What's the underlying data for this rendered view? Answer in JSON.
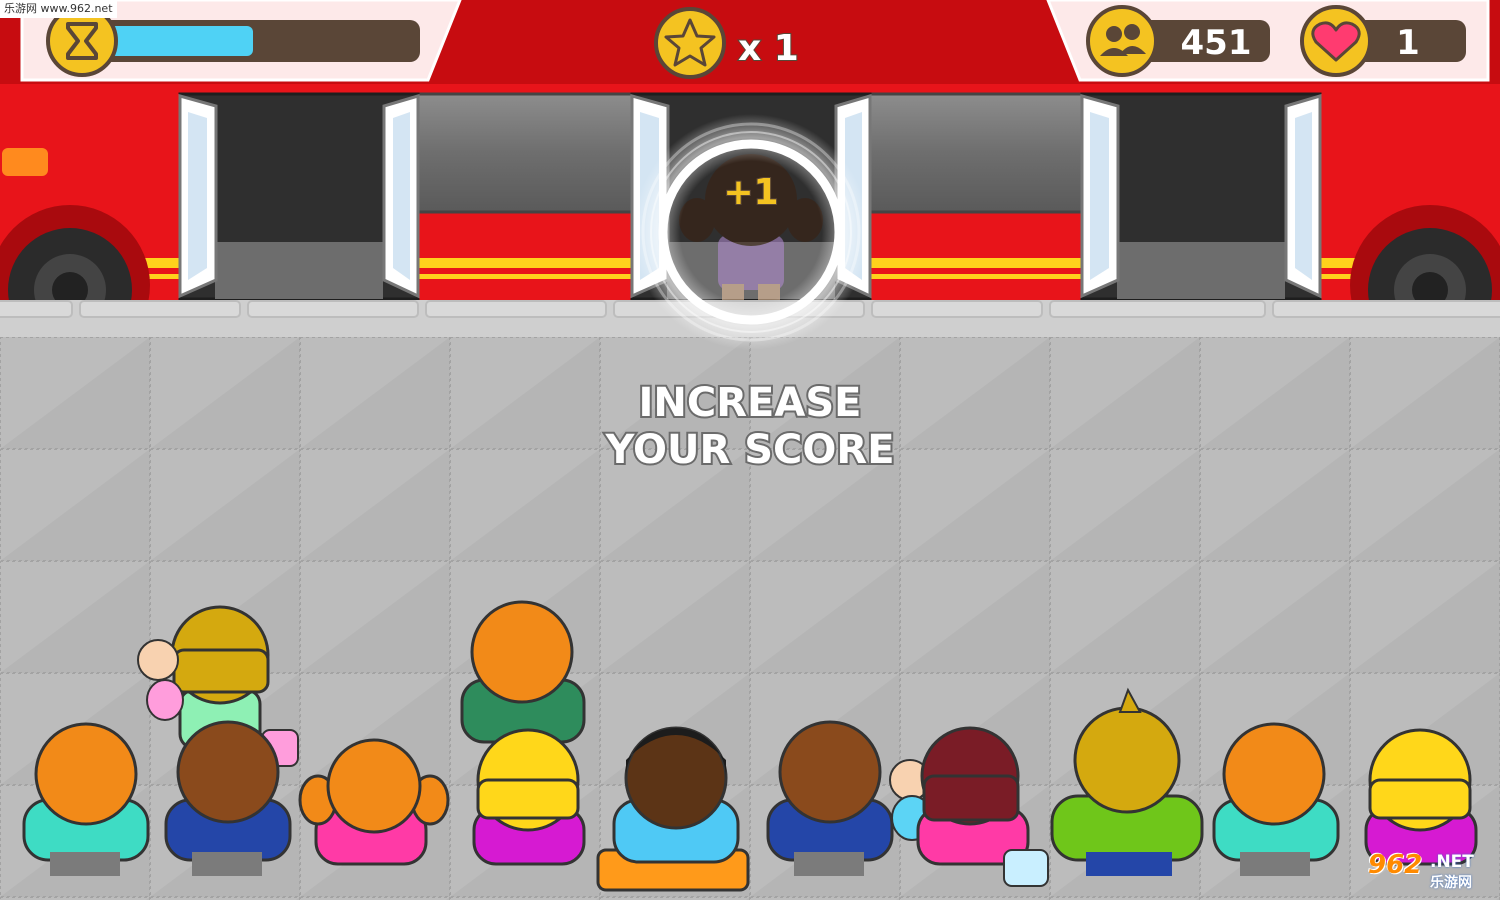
{
  "watermark": {
    "top_text": "乐游网 www.962.net",
    "logo_number": "962",
    "logo_net": ".NET",
    "logo_cn": "乐游网"
  },
  "hud": {
    "timer": {
      "icon": "hourglass-icon",
      "progress": 0.5
    },
    "stars": {
      "icon": "star-icon",
      "multiplier": "x 1"
    },
    "passengers": {
      "icon": "people-icon",
      "count": "451"
    },
    "lives": {
      "icon": "heart-icon",
      "count": "1"
    }
  },
  "feedback": {
    "score_popup": "+1"
  },
  "instruction": {
    "line1": "INCREASE",
    "line2": "YOUR SCORE"
  },
  "colors": {
    "bus_red": "#e8141a",
    "bus_dark_red": "#c70c10",
    "bus_stripe": "#ffd21c",
    "hud_panel": "#fde9e9",
    "hud_gold": "#f4c321",
    "hud_bar_bg": "#5a4637",
    "timer_fill": "#4fd2f5",
    "floor": "#b3b3b3",
    "curb": "#cfcfcf"
  }
}
